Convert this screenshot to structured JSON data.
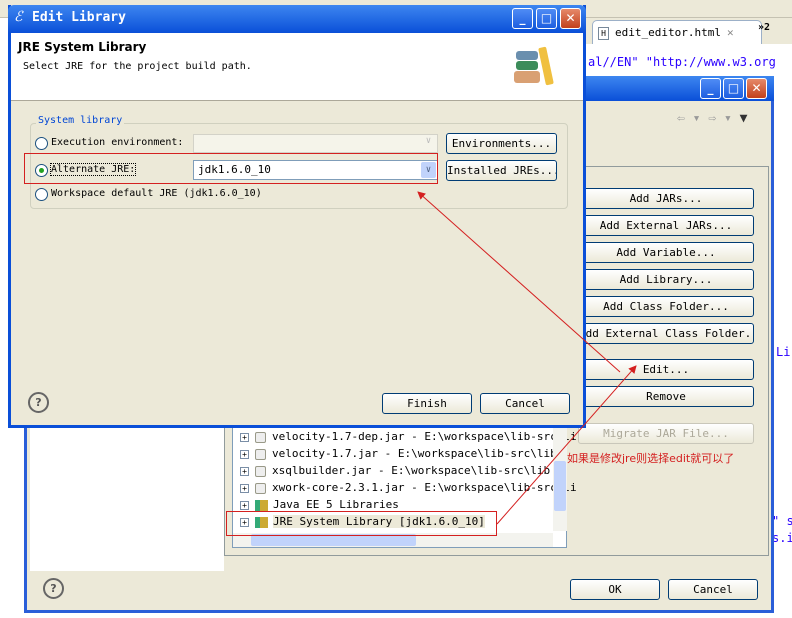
{
  "editor": {
    "tab_label": "edit_editor.html",
    "overflow": "»2",
    "code_top": "al//EN\" \"http://www.w3.org",
    "code_li": "Li",
    "code_s": "\" s",
    "code_si": "s.i"
  },
  "properties_dialog": {
    "buttons": [
      "Add JARs...",
      "Add External JARs...",
      "Add Variable...",
      "Add Library...",
      "Add Class Folder...",
      "Add External Class Folder...",
      "Edit...",
      "Remove",
      "Migrate JAR File..."
    ],
    "tree_items": [
      {
        "label": "velocity-1.7-dep.jar - E:\\workspace\\lib-src\\li",
        "icon": "jar-icon"
      },
      {
        "label": "velocity-1.7.jar - E:\\workspace\\lib-src\\lib",
        "icon": "jar-icon"
      },
      {
        "label": "xsqlbuilder.jar - E:\\workspace\\lib-src\\lib",
        "icon": "jar-icon"
      },
      {
        "label": "xwork-core-2.3.1.jar - E:\\workspace\\lib-src\\li",
        "icon": "jar-icon"
      },
      {
        "label": "Java EE 5 Libraries",
        "icon": "library-icon"
      },
      {
        "label": "JRE System Library [jdk1.6.0_10]",
        "icon": "library-icon"
      }
    ],
    "ok": "OK",
    "cancel": "Cancel"
  },
  "edit_library": {
    "title": "Edit Library",
    "header_title": "JRE System Library",
    "header_desc": "Select JRE for the project build path.",
    "group_label": "System library",
    "exec_env_label": "Execution environment:",
    "environments_button": "Environments...",
    "alternate_jre_label": "Alternate JRE:",
    "alternate_jre_value": "jdk1.6.0_10",
    "installed_jres_button": "Installed JREs...",
    "workspace_default_label": "Workspace default JRE (jdk1.6.0_10)",
    "selected_option": "Alternate JRE",
    "finish": "Finish",
    "cancel": "Cancel"
  },
  "annotation": {
    "text": "如果是修改jre则选择edit就可以了",
    "color": "#d42020"
  }
}
